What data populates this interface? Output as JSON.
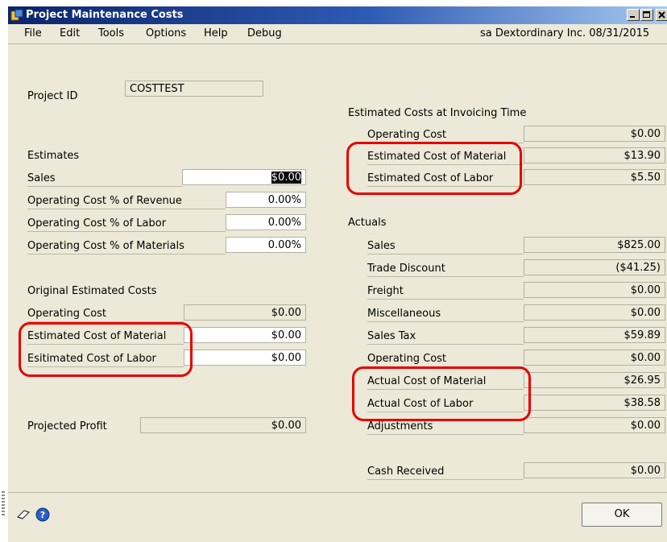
{
  "window": {
    "title": "Project Maintenance Costs"
  },
  "menu": {
    "items": [
      "File",
      "Edit",
      "Tools",
      "Options",
      "Help",
      "Debug"
    ],
    "status": "sa  Dextordinary Inc.  08/31/2015"
  },
  "project": {
    "label": "Project ID",
    "value": "COSTTEST"
  },
  "estimates": {
    "heading": "Estimates",
    "rows": [
      {
        "label": "Sales",
        "value": "$0.00"
      },
      {
        "label": "Operating Cost % of Revenue",
        "value": "0.00%"
      },
      {
        "label": "Operating Cost % of Labor",
        "value": "0.00%"
      },
      {
        "label": "Operating Cost % of Materials",
        "value": "0.00%"
      }
    ]
  },
  "original": {
    "heading": "Original Estimated Costs",
    "rows": [
      {
        "label": "Operating Cost",
        "value": "$0.00"
      },
      {
        "label": "Estimated Cost of Material",
        "value": "$0.00"
      },
      {
        "label": "Esitimated Cost of Labor",
        "value": "$0.00"
      }
    ]
  },
  "projected": {
    "label": "Projected Profit",
    "value": "$0.00"
  },
  "invoicing": {
    "heading": "Estimated Costs at Invoicing Time",
    "rows": [
      {
        "label": "Operating Cost",
        "value": "$0.00"
      },
      {
        "label": "Estimated Cost of Material",
        "value": "$13.90"
      },
      {
        "label": "Estimated Cost of Labor",
        "value": "$5.50"
      }
    ]
  },
  "actuals": {
    "heading": "Actuals",
    "rows": [
      {
        "label": "Sales",
        "value": "$825.00"
      },
      {
        "label": "Trade Discount",
        "value": "($41.25)"
      },
      {
        "label": "Freight",
        "value": "$0.00"
      },
      {
        "label": "Miscellaneous",
        "value": "$0.00"
      },
      {
        "label": "Sales Tax",
        "value": "$59.89"
      },
      {
        "label": "Operating Cost",
        "value": "$0.00"
      },
      {
        "label": "Actual Cost of Material",
        "value": "$26.95"
      },
      {
        "label": "Actual Cost of Labor",
        "value": "$38.58"
      },
      {
        "label": "Adjustments",
        "value": "$0.00"
      }
    ]
  },
  "cash": {
    "label": "Cash Received",
    "value": "$0.00"
  },
  "buttons": {
    "ok": "OK"
  },
  "icons": {
    "note": "note-icon",
    "help": "help-icon",
    "app": "app-icon"
  },
  "colors": {
    "highlight": "#e60000",
    "titlebar": "#0a246a"
  }
}
